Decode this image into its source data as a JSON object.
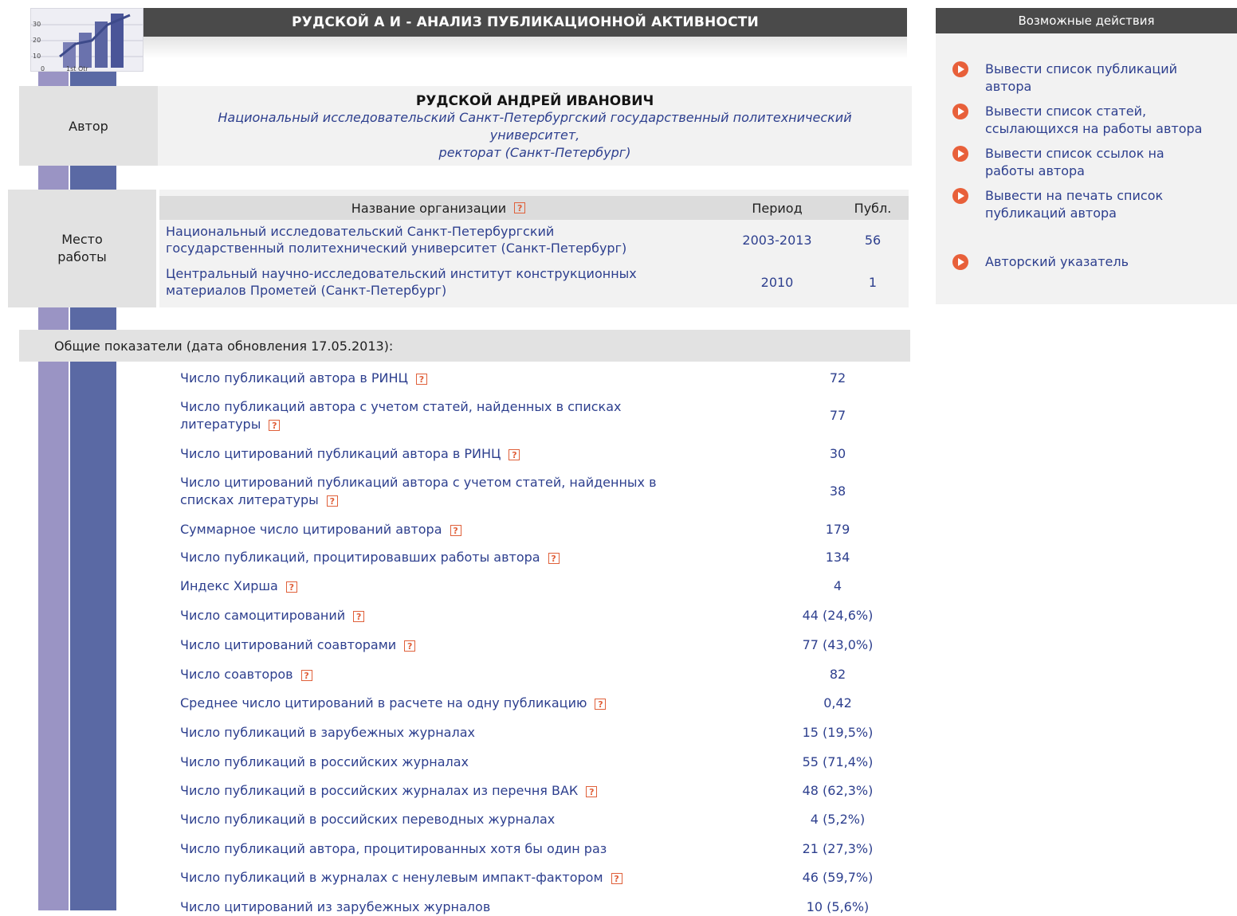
{
  "header": {
    "title": "РУДСКОЙ А И - АНАЛИЗ ПУБЛИКАЦИОННОЙ АКТИВНОСТИ",
    "logo_text": [
      "30",
      "20",
      "10",
      "0",
      "1st Qtr"
    ]
  },
  "author": {
    "label": "Автор",
    "name": "РУДСКОЙ АНДРЕЙ ИВАНОВИЧ",
    "affiliation_line1": "Национальный исследовательский Санкт-Петербургский государственный политехнический",
    "affiliation_line2": "университет,",
    "affiliation_line3": "ректорат (Санкт-Петербург)"
  },
  "workplace": {
    "label_line1": "Место",
    "label_line2": "работы",
    "columns": {
      "org": "Название организации",
      "period": "Период",
      "pubs": "Публ."
    },
    "rows": [
      {
        "org_line1": "Национальный исследовательский Санкт-Петербургский",
        "org_line2": "государственный политехнический университет (Санкт-Петербург)",
        "period": "2003-2013",
        "pubs": "56"
      },
      {
        "org_line1": "Центральный научно-исследовательский институт конструкционных",
        "org_line2": "материалов Прометей (Санкт-Петербург)",
        "period": "2010",
        "pubs": "1"
      }
    ]
  },
  "overview": {
    "title": "Общие показатели (дата обновления 17.05.2013):",
    "help_glyph": "?",
    "metrics": [
      {
        "line1": "Число публикаций автора в РИНЦ",
        "line2": "",
        "value": "72"
      },
      {
        "line1": "Число публикаций автора с учетом статей, найденных в списках",
        "line2": "литературы",
        "value": "77"
      },
      {
        "line1": "Число цитирований публикаций автора в РИНЦ",
        "line2": "",
        "value": "30"
      },
      {
        "line1": "Число цитирований публикаций автора с учетом статей, найденных в",
        "line2": "списках литературы",
        "value": "38"
      },
      {
        "line1": "Суммарное число цитирований автора",
        "line2": "",
        "value": "179"
      },
      {
        "line1": "Число публикаций, процитировавших работы автора",
        "line2": "",
        "value": "134"
      },
      {
        "line1": "Индекс Хирша",
        "line2": "",
        "value": "4"
      },
      {
        "line1": "Число самоцитирований",
        "line2": "",
        "value": "44 (24,6%)"
      },
      {
        "line1": "Число цитирований соавторами",
        "line2": "",
        "value": "77 (43,0%)"
      },
      {
        "line1": "Число соавторов",
        "line2": "",
        "value": "82"
      },
      {
        "line1": "Среднее число цитирований в расчете на одну публикацию",
        "line2": "",
        "value": "0,42"
      },
      {
        "line1": "Число публикаций в зарубежных журналах",
        "line2": "",
        "value": "15 (19,5%)"
      },
      {
        "line1": "Число публикаций в российских журналах",
        "line2": "",
        "value": "55 (71,4%)"
      },
      {
        "line1": "Число публикаций в российских журналах из перечня ВАК",
        "line2": "",
        "value": "48 (62,3%)"
      },
      {
        "line1": "Число публикаций в российских переводных журналах",
        "line2": "",
        "value": "4 (5,2%)"
      },
      {
        "line1": "Число публикаций автора, процитированных хотя бы один раз",
        "line2": "",
        "value": "21 (27,3%)"
      },
      {
        "line1": "Число публикаций в журналах с ненулевым импакт-фактором",
        "line2": "",
        "value": "46 (59,7%)"
      },
      {
        "line1": "Число цитирований из зарубежных журналов",
        "line2": "",
        "value": "10 (5,6%)"
      }
    ]
  },
  "actions": {
    "title": "Возможные действия",
    "items": [
      {
        "line1": "Вывести список публикаций",
        "line2": "автора"
      },
      {
        "line1": "Вывести список статей,",
        "line2": "ссылающихся на работы автора"
      },
      {
        "line1": "Вывести список ссылок на",
        "line2": "работы автора"
      },
      {
        "line1": "Вывести на печать список",
        "line2": "публикаций автора"
      },
      {
        "line1": "Авторский указатель",
        "line2": ""
      }
    ]
  },
  "colors": {
    "header_bg": "#4a4a4a",
    "link": "#2d3f8e",
    "accent": "#e8603a",
    "panel": "#f2f2f2",
    "label_bg": "#e2e2e2"
  },
  "icons": {
    "action": "play-circle-icon",
    "help": "help-icon"
  }
}
